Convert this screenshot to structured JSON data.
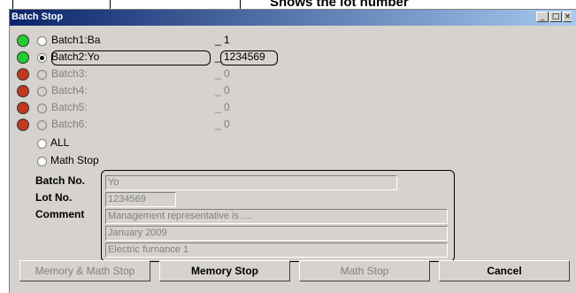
{
  "annotation": {
    "label": "Shows the lot number"
  },
  "window": {
    "title": "Batch Stop"
  },
  "batches": [
    {
      "label": "Batch1:Ba",
      "lot": "_ 1",
      "light": "green",
      "selected": false,
      "enabled": true
    },
    {
      "label": "Batch2:Yo",
      "lot": "_ 1234569",
      "light": "green",
      "selected": true,
      "enabled": true
    },
    {
      "label": "Batch3:",
      "lot": "_ 0",
      "light": "red",
      "selected": false,
      "enabled": false
    },
    {
      "label": "Batch4:",
      "lot": "_ 0",
      "light": "red",
      "selected": false,
      "enabled": false
    },
    {
      "label": "Batch5:",
      "lot": "_ 0",
      "light": "red",
      "selected": false,
      "enabled": false
    },
    {
      "label": "Batch6:",
      "lot": "_ 0",
      "light": "red",
      "selected": false,
      "enabled": false
    }
  ],
  "options": {
    "all": "ALL",
    "math_stop": "Math Stop"
  },
  "form": {
    "batch_no_label": "Batch No.",
    "batch_no": "Yo",
    "lot_no_label": "Lot No.",
    "lot_no": "1234569",
    "comment_label": "Comment",
    "comments": [
      "Management representative is.....",
      "January 2009",
      "Electric furnance 1"
    ]
  },
  "buttons": {
    "memory_math_stop": "Memory & Math Stop",
    "memory_stop": "Memory Stop",
    "math_stop": "Math Stop",
    "cancel": "Cancel"
  },
  "colors": {
    "green_light": "#22cc33",
    "red_light": "#c0391f",
    "titlebar": "#0a246a"
  }
}
